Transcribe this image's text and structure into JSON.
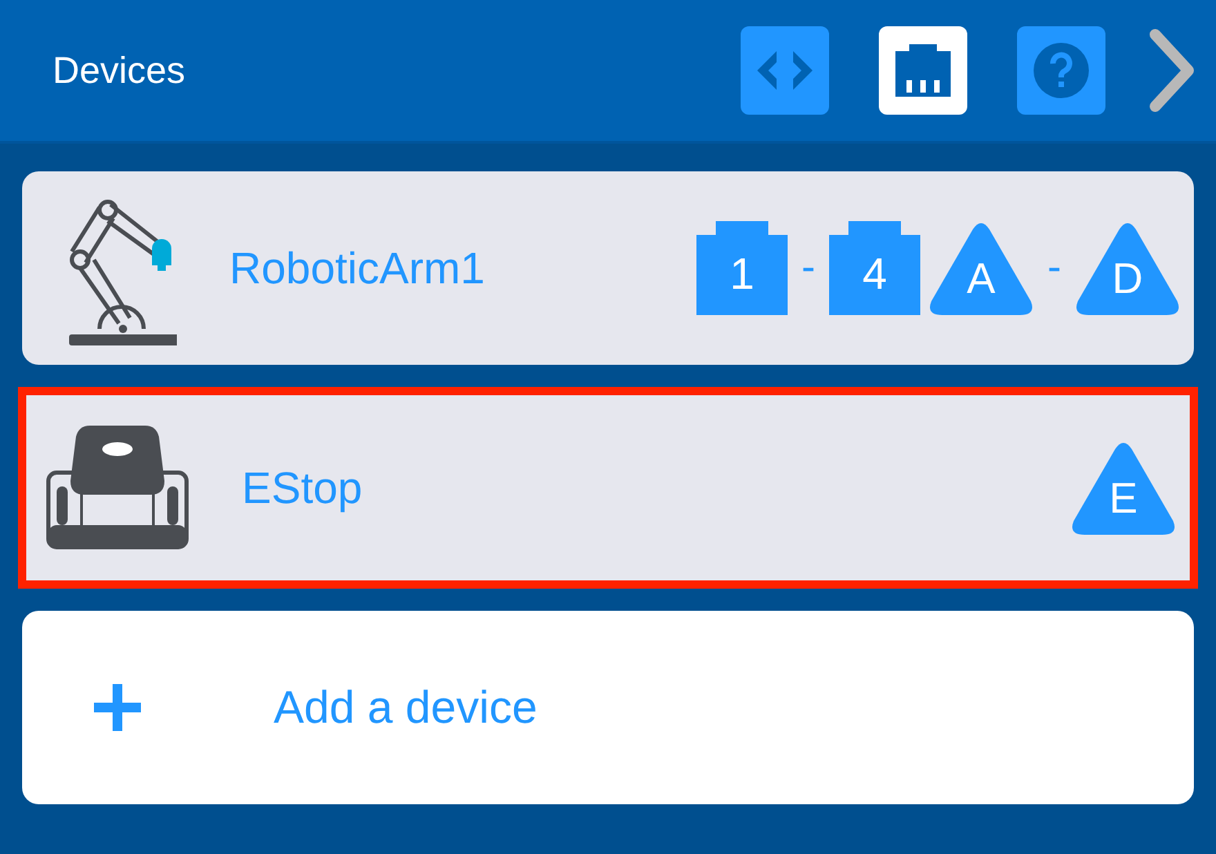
{
  "header": {
    "title": "Devices",
    "tabs": [
      {
        "kind": "code",
        "selected": false
      },
      {
        "kind": "port",
        "selected": true
      },
      {
        "kind": "help",
        "selected": false
      }
    ]
  },
  "devices": [
    {
      "name": "RoboticArm1",
      "kind": "arm",
      "selected": false,
      "ports": [
        {
          "kind": "smart",
          "label": "1"
        },
        {
          "kind": "dash",
          "label": "-"
        },
        {
          "kind": "smart",
          "label": "4"
        },
        {
          "kind": "adi",
          "label": "A"
        },
        {
          "kind": "dash",
          "label": "-"
        },
        {
          "kind": "adi",
          "label": "D"
        }
      ]
    },
    {
      "name": "EStop",
      "kind": "estop",
      "selected": true,
      "ports": [
        {
          "kind": "adi",
          "label": "E"
        }
      ]
    }
  ],
  "add": {
    "label": "Add a device"
  }
}
